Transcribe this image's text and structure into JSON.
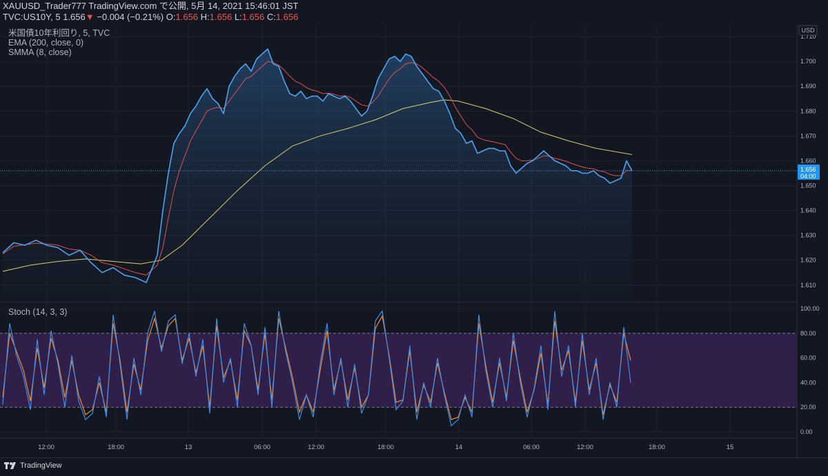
{
  "header": {
    "line1": "XAUUSD_Trader777 TradingView.com で公開, 5月 14, 2021 15:46:01 JST",
    "line2_symbol": "TVC:US10Y, 5",
    "line2_price": "1.656",
    "line2_change": "−0.004 (−0.21%)",
    "line2_ohlc_o": "O:",
    "line2_o": "1.656",
    "line2_ohlc_h": "H:",
    "line2_h": "1.656",
    "line2_ohlc_l": "L:",
    "line2_l": "1.656",
    "line2_ohlc_c": "C:",
    "line2_c": "1.656"
  },
  "legend": {
    "symbol_name": "米国債10年利回り, 5, TVC",
    "ema": "EMA (200, close, 0)",
    "smma": "SMMA (8, close)"
  },
  "stoch_label": "Stoch (14, 3, 3)",
  "price_axis": {
    "currency": "USD",
    "ticks": [
      "1.710",
      "1.700",
      "1.690",
      "1.680",
      "1.670",
      "1.660",
      "1.650",
      "1.640",
      "1.630",
      "1.620",
      "1.610"
    ],
    "last_price": "1.656",
    "countdown": "04:00"
  },
  "stoch_axis": {
    "ticks": [
      "100.00",
      "80.00",
      "60.00",
      "40.00",
      "20.00",
      "0.00"
    ]
  },
  "time_axis": {
    "ticks": [
      "12:00",
      "18:00",
      "13",
      "06:00",
      "12:00",
      "18:00",
      "14",
      "06:00",
      "12:00",
      "18:00",
      "15"
    ]
  },
  "footer": {
    "brand": "TradingView"
  },
  "colors": {
    "background": "#131722",
    "price_line": "#4da3f0",
    "ema": "#d8cf6a",
    "smma": "#e0504f",
    "stoch_k": "#3d8ee6",
    "stoch_d": "#f08a2a",
    "stoch_band": "#33204e"
  },
  "chart_data": [
    {
      "type": "line",
      "series": [
        {
          "name": "米国債10年利回り",
          "x": [
            0,
            16,
            32,
            48,
            64,
            80,
            96,
            112,
            128,
            144,
            160,
            176,
            192,
            208,
            224,
            232,
            240,
            248,
            256,
            264,
            272,
            280,
            288,
            296,
            304,
            312,
            320,
            328,
            336,
            344,
            352,
            360,
            368,
            376,
            384,
            392,
            400,
            408,
            416,
            424,
            432,
            440,
            448,
            456,
            464,
            472,
            480,
            488,
            496,
            504,
            512,
            520,
            528,
            536,
            544,
            552,
            560,
            568,
            576,
            584,
            592,
            600,
            608,
            616,
            624,
            632,
            640,
            648,
            656,
            664,
            672,
            680,
            688,
            696,
            704,
            712,
            720,
            728,
            736,
            744,
            752,
            760,
            768,
            776,
            784,
            792,
            800,
            808,
            816,
            824,
            832,
            840,
            848,
            856,
            864,
            872,
            880,
            888,
            896,
            904,
            912
          ],
          "values": [
            1.623,
            1.627,
            1.626,
            1.628,
            1.626,
            1.625,
            1.622,
            1.624,
            1.619,
            1.615,
            1.617,
            1.614,
            1.613,
            1.611,
            1.622,
            1.64,
            1.655,
            1.667,
            1.671,
            1.674,
            1.679,
            1.682,
            1.686,
            1.689,
            1.685,
            1.683,
            1.679,
            1.69,
            1.694,
            1.697,
            1.699,
            1.696,
            1.701,
            1.703,
            1.705,
            1.699,
            1.698,
            1.692,
            1.687,
            1.686,
            1.688,
            1.685,
            1.686,
            1.686,
            1.684,
            1.687,
            1.686,
            1.685,
            1.686,
            1.684,
            1.681,
            1.678,
            1.68,
            1.686,
            1.693,
            1.697,
            1.701,
            1.702,
            1.7,
            1.703,
            1.702,
            1.698,
            1.695,
            1.692,
            1.689,
            1.688,
            1.684,
            1.679,
            1.673,
            1.671,
            1.667,
            1.668,
            1.663,
            1.664,
            1.665,
            1.665,
            1.664,
            1.664,
            1.658,
            1.655,
            1.657,
            1.659,
            1.66,
            1.662,
            1.664,
            1.662,
            1.66,
            1.659,
            1.658,
            1.656,
            1.656,
            1.655,
            1.655,
            1.656,
            1.654,
            1.653,
            1.651,
            1.652,
            1.653,
            1.66,
            1.656
          ]
        },
        {
          "name": "EMA (200, close, 0)",
          "x": [
            0,
            40,
            80,
            120,
            160,
            200,
            230,
            260,
            300,
            340,
            380,
            420,
            460,
            500,
            540,
            580,
            620,
            640,
            660,
            700,
            740,
            780,
            820,
            860,
            912
          ],
          "values": [
            1.6155,
            1.618,
            1.6195,
            1.6205,
            1.6195,
            1.6185,
            1.62,
            1.626,
            1.637,
            1.648,
            1.658,
            1.666,
            1.67,
            1.673,
            1.6765,
            1.681,
            1.6835,
            1.6845,
            1.684,
            1.681,
            1.677,
            1.6715,
            1.668,
            1.665,
            1.6625
          ]
        },
        {
          "name": "SMMA (8, close)",
          "x": [
            0,
            16,
            32,
            48,
            64,
            80,
            96,
            112,
            128,
            144,
            160,
            176,
            192,
            208,
            224,
            232,
            240,
            248,
            256,
            264,
            272,
            280,
            288,
            296,
            304,
            312,
            320,
            328,
            336,
            344,
            352,
            360,
            368,
            376,
            384,
            392,
            400,
            408,
            416,
            424,
            432,
            440,
            448,
            456,
            464,
            472,
            480,
            488,
            496,
            504,
            512,
            520,
            528,
            536,
            544,
            552,
            560,
            568,
            576,
            584,
            592,
            600,
            608,
            616,
            624,
            632,
            640,
            648,
            656,
            664,
            672,
            680,
            688,
            696,
            704,
            712,
            720,
            728,
            736,
            744,
            752,
            760,
            768,
            776,
            784,
            792,
            800,
            808,
            816,
            824,
            832,
            840,
            848,
            856,
            864,
            872,
            880,
            888,
            896,
            904,
            912
          ],
          "values": [
            1.6225,
            1.6256,
            1.6262,
            1.6268,
            1.6265,
            1.626,
            1.6245,
            1.624,
            1.622,
            1.619,
            1.618,
            1.6165,
            1.615,
            1.614,
            1.618,
            1.625,
            1.637,
            1.648,
            1.656,
            1.662,
            1.668,
            1.672,
            1.676,
            1.68,
            1.681,
            1.6815,
            1.681,
            1.684,
            1.687,
            1.69,
            1.693,
            1.694,
            1.696,
            1.698,
            1.7,
            1.6995,
            1.6985,
            1.6965,
            1.694,
            1.692,
            1.691,
            1.6895,
            1.6885,
            1.688,
            1.687,
            1.6872,
            1.6868,
            1.686,
            1.6862,
            1.6855,
            1.684,
            1.6825,
            1.682,
            1.6835,
            1.686,
            1.6895,
            1.693,
            1.6955,
            1.697,
            1.699,
            1.6995,
            1.699,
            1.6975,
            1.6955,
            1.6935,
            1.692,
            1.6895,
            1.686,
            1.6815,
            1.678,
            1.6745,
            1.6725,
            1.6695,
            1.6685,
            1.668,
            1.6675,
            1.667,
            1.6665,
            1.6635,
            1.661,
            1.66,
            1.66,
            1.6603,
            1.661,
            1.662,
            1.6618,
            1.661,
            1.6605,
            1.6598,
            1.659,
            1.6582,
            1.6575,
            1.657,
            1.6568,
            1.656,
            1.6555,
            1.6545,
            1.654,
            1.654,
            1.656,
            1.656
          ]
        }
      ],
      "ylim": [
        1.603,
        1.715
      ],
      "grid": true
    },
    {
      "type": "line",
      "series": [
        {
          "x": [
            0,
            10,
            20,
            30,
            40,
            50,
            60,
            70,
            80,
            90,
            100,
            110,
            120,
            130,
            140,
            150,
            160,
            170,
            180,
            190,
            200,
            210,
            220,
            230,
            240,
            250,
            260,
            270,
            280,
            290,
            300,
            310,
            320,
            330,
            340,
            350,
            360,
            370,
            380,
            390,
            400,
            410,
            420,
            430,
            440,
            450,
            460,
            470,
            480,
            490,
            500,
            510,
            520,
            530,
            540,
            550,
            560,
            570,
            580,
            590,
            600,
            610,
            620,
            630,
            640,
            650,
            660,
            670,
            680,
            690,
            700,
            710,
            720,
            730,
            740,
            750,
            760,
            770,
            780,
            790,
            800,
            810,
            820,
            830,
            840,
            850,
            860,
            870,
            880,
            890,
            900,
            910
          ],
          "values": [
            22,
            88,
            62,
            45,
            18,
            75,
            30,
            82,
            55,
            20,
            62,
            25,
            10,
            15,
            45,
            12,
            95,
            55,
            10,
            60,
            30,
            80,
            98,
            65,
            90,
            95,
            55,
            80,
            45,
            75,
            15,
            92,
            40,
            60,
            20,
            88,
            70,
            30,
            85,
            20,
            98,
            65,
            40,
            10,
            30,
            12,
            55,
            88,
            30,
            60,
            20,
            55,
            15,
            30,
            90,
            98,
            60,
            18,
            25,
            70,
            10,
            40,
            20,
            60,
            30,
            5,
            10,
            30,
            12,
            95,
            50,
            20,
            60,
            25,
            80,
            40,
            12,
            35,
            70,
            18,
            98,
            45,
            70,
            20,
            80,
            30,
            60,
            10,
            40,
            20,
            85,
            40
          ],
          "name": ""
        },
        {
          "x": [
            0,
            10,
            20,
            30,
            40,
            50,
            60,
            70,
            80,
            90,
            100,
            110,
            120,
            130,
            140,
            150,
            160,
            170,
            180,
            190,
            200,
            210,
            220,
            230,
            240,
            250,
            260,
            270,
            280,
            290,
            300,
            310,
            320,
            330,
            340,
            350,
            360,
            370,
            380,
            390,
            400,
            410,
            420,
            430,
            440,
            450,
            460,
            470,
            480,
            490,
            500,
            510,
            520,
            530,
            540,
            550,
            560,
            570,
            580,
            590,
            600,
            610,
            620,
            630,
            640,
            650,
            660,
            670,
            680,
            690,
            700,
            710,
            720,
            730,
            740,
            750,
            760,
            770,
            780,
            790,
            800,
            810,
            820,
            830,
            840,
            850,
            860,
            870,
            880,
            890,
            900,
            910
          ],
          "values": [
            28,
            80,
            65,
            50,
            25,
            68,
            36,
            76,
            58,
            28,
            58,
            30,
            14,
            18,
            40,
            16,
            88,
            58,
            16,
            55,
            34,
            74,
            92,
            68,
            86,
            92,
            58,
            76,
            48,
            70,
            20,
            86,
            44,
            58,
            26,
            82,
            70,
            34,
            80,
            26,
            92,
            68,
            44,
            16,
            30,
            16,
            50,
            82,
            34,
            58,
            26,
            52,
            20,
            30,
            84,
            94,
            62,
            24,
            26,
            66,
            16,
            38,
            24,
            56,
            32,
            10,
            12,
            28,
            16,
            88,
            54,
            24,
            56,
            28,
            74,
            44,
            16,
            34,
            64,
            22,
            90,
            50,
            66,
            24,
            74,
            34,
            56,
            14,
            38,
            24,
            80,
            58
          ],
          "name": ""
        }
      ],
      "ylim": [
        -5,
        105
      ],
      "bands": [
        20,
        80
      ]
    }
  ]
}
